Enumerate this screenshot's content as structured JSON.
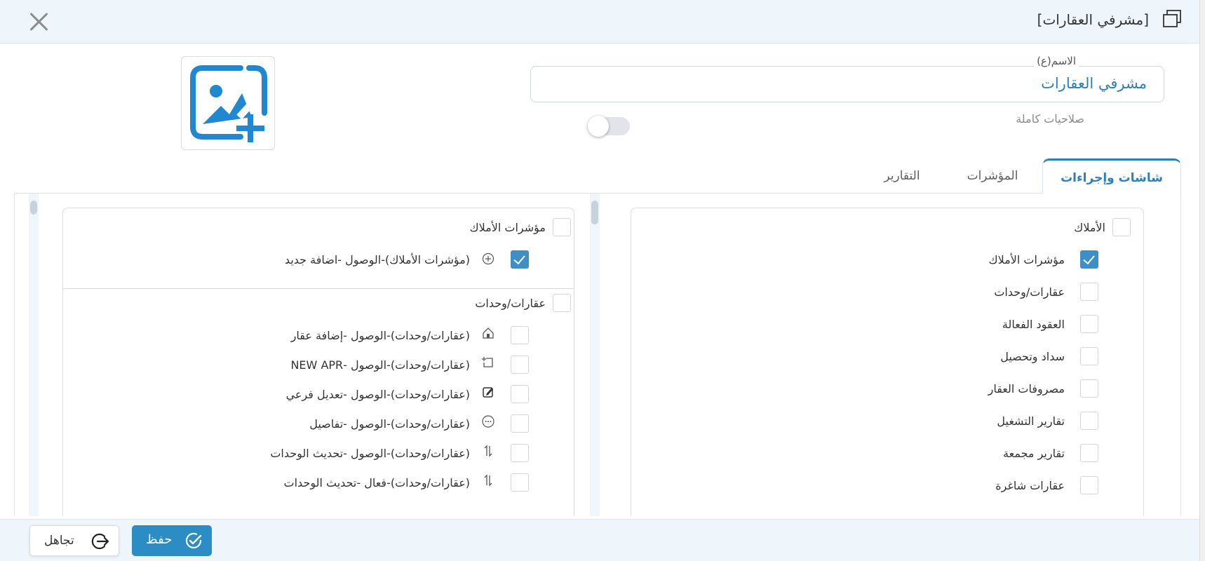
{
  "header": {
    "title": "[مشرفي العقارات]"
  },
  "form": {
    "name_label": "الاسم(ع)",
    "name_value": "مشرفي العقارات",
    "full_permissions_label": "صلاحيات كاملة",
    "full_permissions_enabled": false
  },
  "tabs": [
    {
      "label": "شاشات وإجراءات",
      "active": true
    },
    {
      "label": "المؤشرات",
      "active": false
    },
    {
      "label": "التقارير",
      "active": false
    }
  ],
  "modules_panel": {
    "header": {
      "label": "الأملاك",
      "checked": false
    },
    "items": [
      {
        "label": "مؤشرات الأملاك",
        "checked": true
      },
      {
        "label": "عقارات/وحدات",
        "checked": false
      },
      {
        "label": "العقود الفعالة",
        "checked": false
      },
      {
        "label": "سداد وتحصيل",
        "checked": false
      },
      {
        "label": "مصروفات العقار",
        "checked": false
      },
      {
        "label": "تقارير التشغيل",
        "checked": false
      },
      {
        "label": "تقارير مجمعة",
        "checked": false
      },
      {
        "label": "عقارات شاغرة",
        "checked": false
      }
    ]
  },
  "actions_panel": {
    "groups": [
      {
        "label": "مؤشرات الأملاك",
        "checked": false,
        "actions": [
          {
            "label": "(مؤشرات الأملاك)-الوصول -اضافة جديد",
            "icon": "plus-circle-icon",
            "checked": true
          }
        ]
      },
      {
        "label": "عقارات/وحدات",
        "checked": false,
        "actions": [
          {
            "label": "(عقارات/وحدات)-الوصول -إضافة عقار",
            "icon": "home-icon",
            "checked": false
          },
          {
            "label": "(عقارات/وحدات)-الوصول -NEW APR",
            "icon": "add-copy-icon",
            "checked": false
          },
          {
            "label": "(عقارات/وحدات)-الوصول -تعديل فرعي",
            "icon": "edit-icon",
            "checked": false
          },
          {
            "label": "(عقارات/وحدات)-الوصول -تفاصيل",
            "icon": "more-circle-icon",
            "checked": false
          },
          {
            "label": "(عقارات/وحدات)-الوصول -تحديث الوحدات",
            "icon": "sort-icon",
            "checked": false
          },
          {
            "label": "(عقارات/وحدات)-فعال -تحديث الوحدات",
            "icon": "sort-icon",
            "checked": false
          }
        ]
      }
    ]
  },
  "footer": {
    "save_label": "حفظ",
    "ignore_label": "تجاهل"
  },
  "colors": {
    "accent": "#2c7fb8",
    "checkbox_checked": "#3d8fc6",
    "header_bg": "#eef5fb"
  }
}
